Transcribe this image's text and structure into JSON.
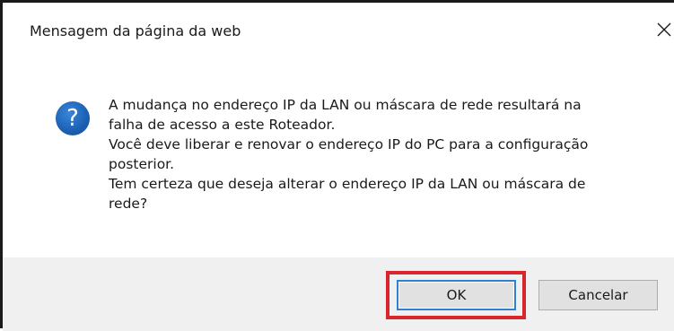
{
  "dialog": {
    "title": "Mensagem da página da web",
    "close_icon": "close-icon",
    "question_icon": "question-icon",
    "question_symbol": "?",
    "message_lines": [
      "A mudança no endereço IP da LAN ou máscara de rede resultará na",
      "falha de acesso a este Roteador.",
      "Você deve liberar e renovar o endereço IP do PC para a configuração",
      "posterior.",
      "Tem certeza que deseja alterar o endereço IP da LAN ou máscara de",
      "rede?"
    ],
    "buttons": {
      "ok_label": "OK",
      "cancel_label": "Cancelar"
    },
    "highlight_color": "#d9262c",
    "accent_color": "#2f7fd2"
  }
}
